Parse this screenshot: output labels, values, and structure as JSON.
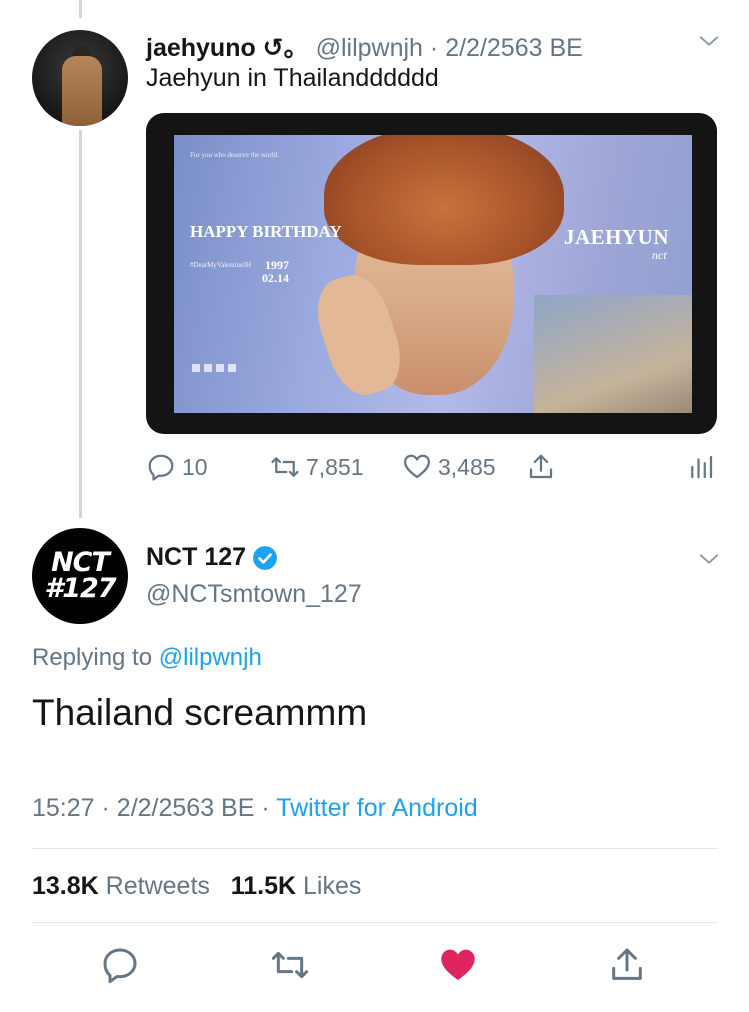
{
  "parent_tweet": {
    "display_name": "jaehyuno ↺。",
    "handle": "@lilpwnjh",
    "date": "2/2/2563 BE",
    "text": "Jaehyun in Thailandddddd",
    "media": {
      "top_caption": "For you who deserve the world.",
      "happy_birthday": "HAPPY BIRTHDAY",
      "hashtag": "#DearMyValentineJH",
      "year": "1997",
      "date": "02.14",
      "name": "JAEHYUN",
      "group": "nct"
    },
    "actions": {
      "replies": "10",
      "retweets": "7,851",
      "likes": "3,485"
    }
  },
  "main_tweet": {
    "avatar_line1": "NCT",
    "avatar_line2": "#127",
    "display_name": "NCT 127",
    "verified": true,
    "handle": "@NCTsmtown_127",
    "replying_prefix": "Replying to",
    "replying_to": "@lilpwnjh",
    "text": "Thailand screammm",
    "time": "15:27",
    "date": "2/2/2563 BE",
    "source": "Twitter for Android",
    "retweets_count": "13.8K",
    "retweets_label": "Retweets",
    "likes_count": "11.5K",
    "likes_label": "Likes"
  },
  "colors": {
    "link_blue": "#1da1f2",
    "muted_gray": "#657786",
    "like_red": "#e0245e",
    "verified_blue": "#1da1f2"
  },
  "icons": [
    "chevron-down-icon",
    "reply-icon",
    "retweet-icon",
    "like-icon",
    "share-icon",
    "analytics-icon",
    "verified-icon"
  ]
}
